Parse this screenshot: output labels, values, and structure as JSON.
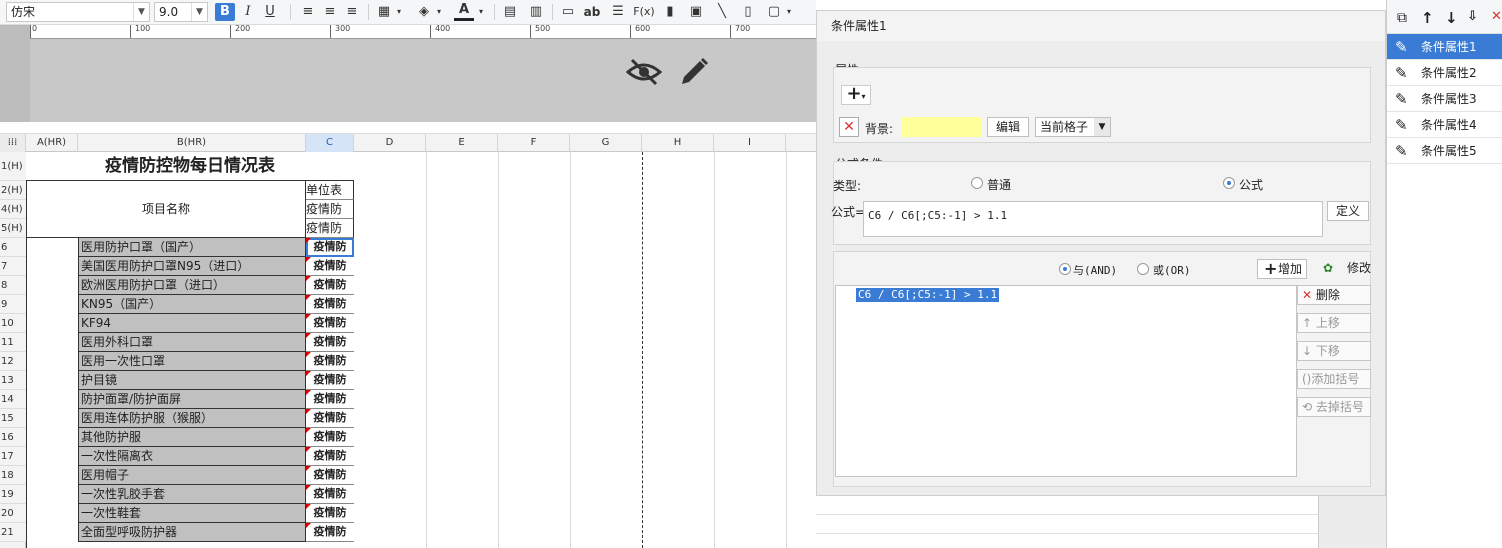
{
  "toolbar": {
    "font_name": "仿宋",
    "font_size": "9.0",
    "bold": "B",
    "italic": "I",
    "underline": "U",
    "text_label": "ab",
    "fx": "F(x)"
  },
  "ruler": {
    "ticks": [
      "0",
      "100",
      "200",
      "300",
      "400",
      "500",
      "600",
      "700"
    ]
  },
  "sheet": {
    "columns": [
      "A(HR)",
      "B(HR)",
      "C",
      "D",
      "E",
      "F",
      "G",
      "H",
      "I"
    ],
    "title": "疫情防控物每日情况表",
    "header_item": "项目名称",
    "header_c": [
      "单位表",
      "疫情防",
      "疫情防"
    ],
    "header_rows": [
      "1(H)",
      "2(H)",
      "4(H)",
      "5(H)"
    ],
    "rows": [
      {
        "num": "6",
        "name": "医用防护口罩（国产）",
        "c": "疫情防"
      },
      {
        "num": "7",
        "name": "美国医用防护口罩N95（进口）",
        "c": "疫情防"
      },
      {
        "num": "8",
        "name": "欧洲医用防护口罩（进口）",
        "c": "疫情防"
      },
      {
        "num": "9",
        "name": "KN95（国产）",
        "c": "疫情防"
      },
      {
        "num": "10",
        "name": "KF94",
        "c": "疫情防"
      },
      {
        "num": "11",
        "name": "医用外科口罩",
        "c": "疫情防"
      },
      {
        "num": "12",
        "name": "医用一次性口罩",
        "c": "疫情防"
      },
      {
        "num": "13",
        "name": "护目镜",
        "c": "疫情防"
      },
      {
        "num": "14",
        "name": "防护面罩/防护面屏",
        "c": "疫情防"
      },
      {
        "num": "15",
        "name": "医用连体防护服（猴服）",
        "c": "疫情防"
      },
      {
        "num": "16",
        "name": "其他防护服",
        "c": "疫情防"
      },
      {
        "num": "17",
        "name": "一次性隔离衣",
        "c": "疫情防"
      },
      {
        "num": "18",
        "name": "医用帽子",
        "c": "疫情防"
      },
      {
        "num": "19",
        "name": "一次性乳胶手套",
        "c": "疫情防"
      },
      {
        "num": "20",
        "name": "一次性鞋套",
        "c": "疫情防"
      },
      {
        "num": "21",
        "name": "全面型呼吸防护器",
        "c": "疫情防"
      }
    ]
  },
  "dialog": {
    "title": "条件属性1",
    "attributes_label": "属性",
    "add_symbol": "+",
    "background_label": "背景:",
    "background_color": "#ffff99",
    "edit_button": "编辑",
    "scope_select": "当前格子",
    "formula_condition_label": "公式条件",
    "type_label": "类型:",
    "type_normal": "普通",
    "type_formula": "公式",
    "formula_label": "公式=",
    "formula_value": "C6 / C6[;C5:-1] > 1.1",
    "define_button": "定义",
    "and_label": "与(AND)",
    "or_label": "或(OR)",
    "add_button": "增加",
    "modify_button": "修改",
    "condition_item": "C6 / C6[;C5:-1] > 1.1",
    "delete_button": "删除",
    "move_up_button": "上移",
    "move_down_button": "下移",
    "add_bracket_button": "添加括号",
    "remove_bracket_button": "去掉括号"
  },
  "condition_list": {
    "items": [
      "条件属性1",
      "条件属性2",
      "条件属性3",
      "条件属性4",
      "条件属性5"
    ],
    "selected": 0
  },
  "colors": {
    "accent": "#3a7bd5",
    "gray_cell": "#c0c0c0",
    "highlight": "#3a7bd5"
  }
}
